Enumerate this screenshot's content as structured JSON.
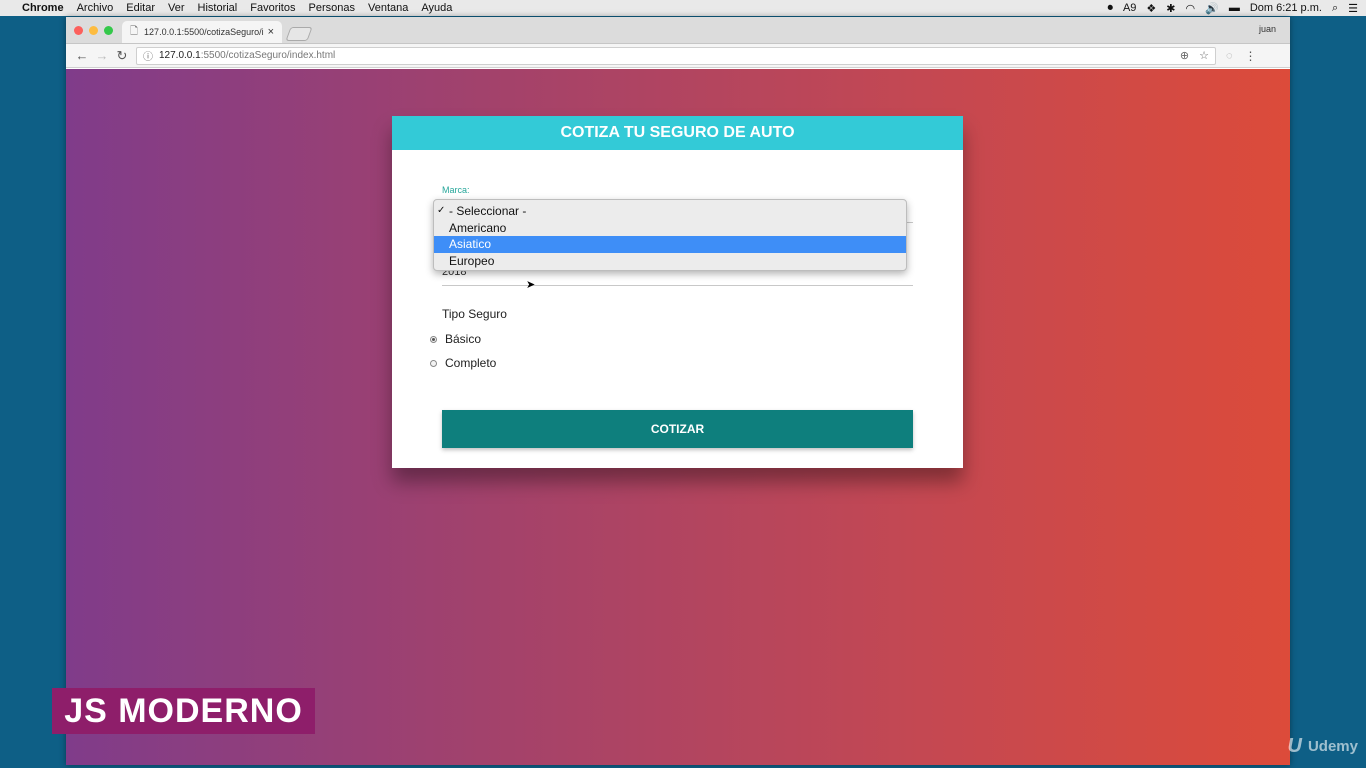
{
  "menubar": {
    "app": "Chrome",
    "items": [
      "Archivo",
      "Editar",
      "Ver",
      "Historial",
      "Favoritos",
      "Personas",
      "Ventana",
      "Ayuda"
    ],
    "status_badge": "9",
    "clock": "Dom 6:21 p.m."
  },
  "browser": {
    "tab_title": "127.0.0.1:5500/cotizaSeguro/i",
    "profile": "juan",
    "url_host": "127.0.0.1",
    "url_path": ":5500/cotizaSeguro/index.html"
  },
  "form": {
    "header": "COTIZA TU SEGURO DE AUTO",
    "marca_label": "Marca:",
    "marca_options": [
      "- Seleccionar -",
      "Americano",
      "Asiatico",
      "Europeo"
    ],
    "marca_checked": "- Seleccionar -",
    "marca_highlighted": "Asiatico",
    "year_value": "2018",
    "tipo_label": "Tipo Seguro",
    "radio_basico": "Básico",
    "radio_completo": "Completo",
    "radio_selected": "Básico",
    "submit_label": "COTIZAR"
  },
  "overlay": {
    "badge": "JS MODERNO",
    "watermark": "Udemy"
  },
  "colors": {
    "header_accent": "#33cad7",
    "button": "#0e7f7d",
    "label_green": "#26a69a",
    "dropdown_highlight": "#3e8ef7",
    "badge_bg": "#8e1e6a"
  }
}
